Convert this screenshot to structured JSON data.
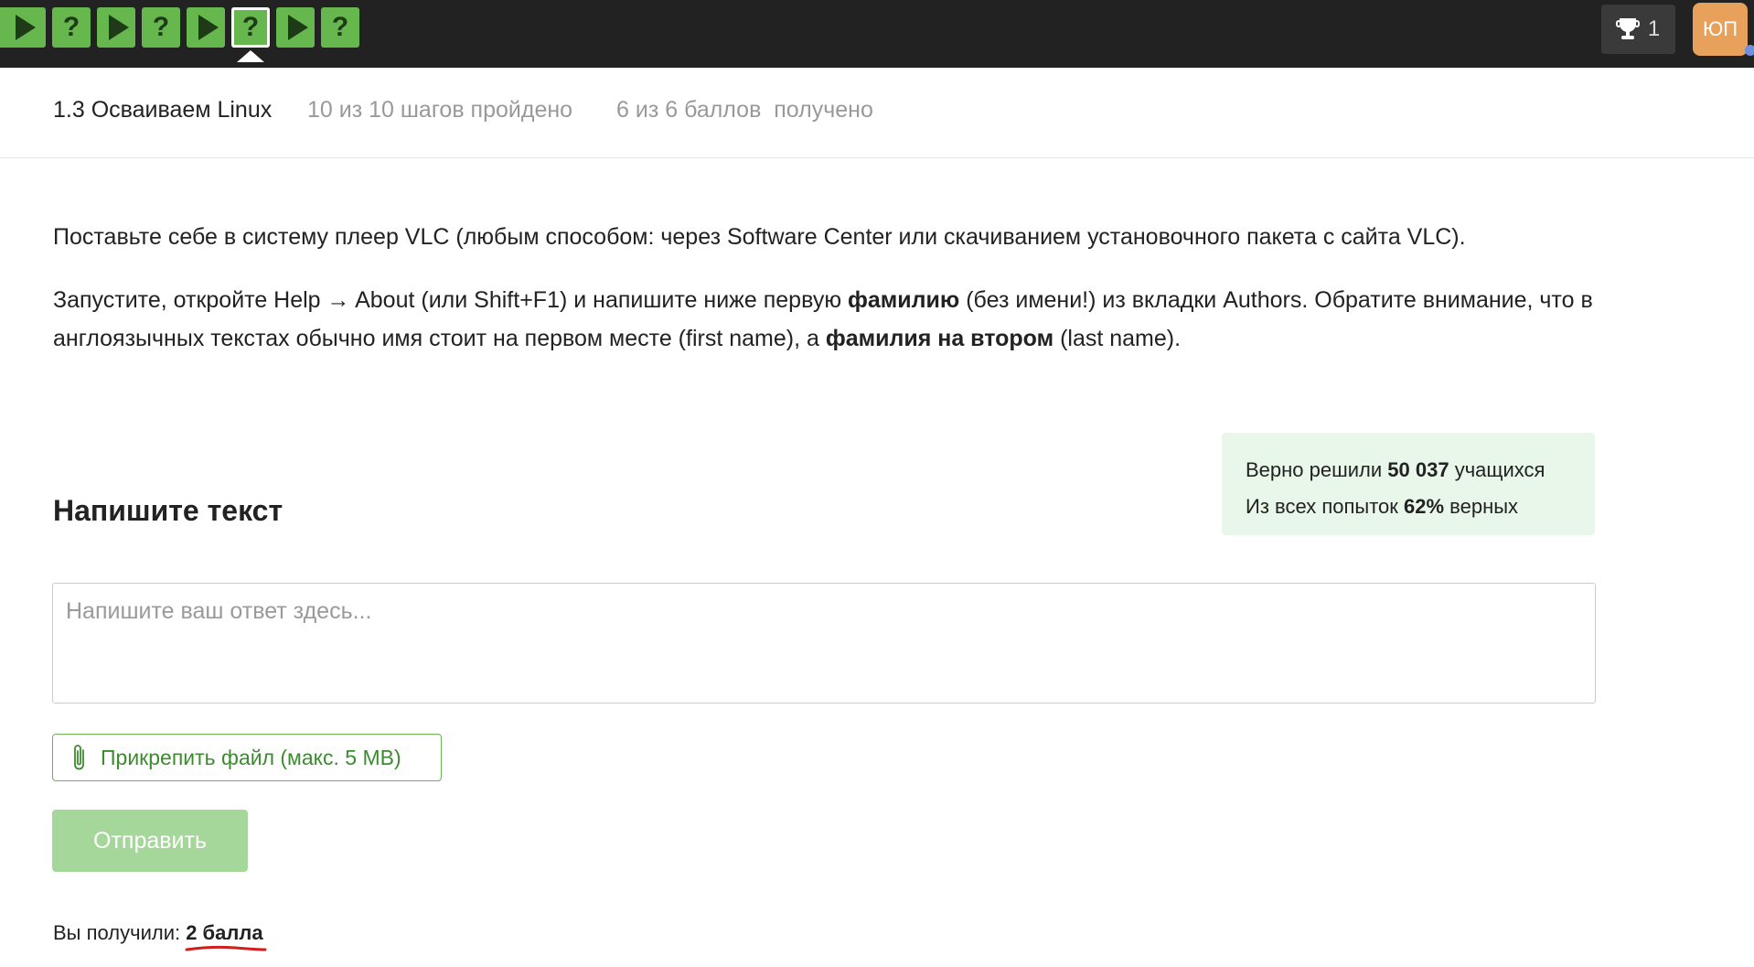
{
  "topbar": {
    "steps": [
      {
        "type": "video"
      },
      {
        "type": "quiz",
        "symbol": "?"
      },
      {
        "type": "video"
      },
      {
        "type": "quiz",
        "symbol": "?"
      },
      {
        "type": "video"
      },
      {
        "type": "quiz",
        "symbol": "?",
        "active": true
      },
      {
        "type": "video"
      },
      {
        "type": "quiz",
        "symbol": "?"
      }
    ],
    "trophy_count": "1",
    "avatar_initials": "ЮП",
    "colors": {
      "bar": "#222222",
      "step": "#66b84e",
      "avatar": "#e8a15a"
    }
  },
  "lesson": {
    "title": "1.3 Осваиваем Linux",
    "progress": "10 из 10 шагов пройдено",
    "score": "6 из 6 баллов  получено"
  },
  "task": {
    "p1": "Поставьте себе в систему плеер VLC (любым способом: через Software Center или скачиванием установочного пакета с сайта VLC).",
    "p2_a": "Запустите, откройте Help → About (или Shift+F1) и напишите ниже первую ",
    "p2_b": "фамилию",
    "p2_c": " (без имени!) из вкладки Authors. Обратите внимание, что в англоязычных текстах обычно имя стоит на первом месте (first name), а ",
    "p2_d": "фамилия на втором",
    "p2_e": " (last name).",
    "heading": "Напишите текст"
  },
  "stats": {
    "line1_prefix": "Верно решили ",
    "line1_value": "50 037",
    "line1_suffix": " учащихся",
    "line2_prefix": "Из всех попыток ",
    "line2_value": "62%",
    "line2_suffix": " верных"
  },
  "answer": {
    "placeholder": "Напишите ваш ответ здесь...",
    "value": ""
  },
  "attach_label": "Прикрепить файл (макс. 5 MB)",
  "submit_label": "Отправить",
  "result": {
    "prefix": "Вы получили: ",
    "score": "2 балла"
  }
}
